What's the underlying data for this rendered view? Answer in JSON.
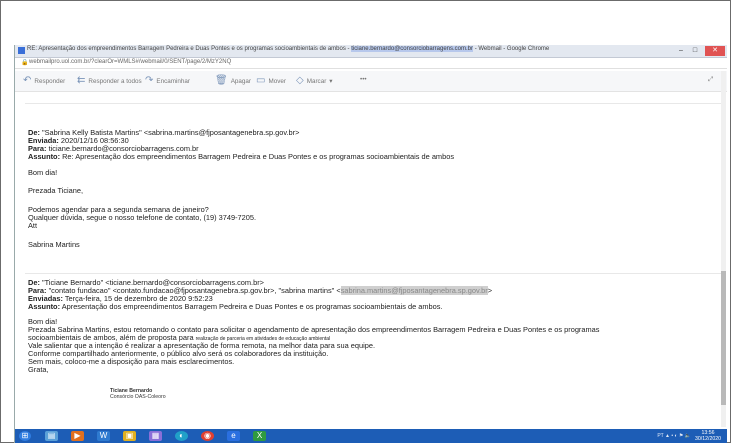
{
  "window": {
    "title_prefix": "RE: Apresentação dos empreendimentos Barragem Pedreira e Duas Pontes e os programas socioambientais de ambos -",
    "title_highlight": "ticiane.bernardo@consorciobarragens.com.br",
    "title_suffix": "- Webmail - Google Chrome",
    "min": "–",
    "max": "□",
    "close": "✕"
  },
  "address": {
    "url": "webmailpro.uol.com.br/?clearOr=WMLS#/webmail/0/SENT/page/2/MzY2NQ"
  },
  "toolbar": {
    "reply": "Responder",
    "reply_all": "Responder a todos",
    "forward": "Encaminhar",
    "delete": "Apagar",
    "move": "Mover",
    "mark": "Marcar",
    "mark_arrow": "▾",
    "more": "•••",
    "expand": "⤢"
  },
  "message1": {
    "from_label": "De:",
    "from_value": "\"Sabrina Kelly Batista Martins\" <sabrina.martins@fjposantagenebra.sp.gov.br>",
    "sent_label": "Enviada:",
    "sent_value": "2020/12/16 08:56:30",
    "to_label": "Para:",
    "to_value": "ticiane.bernardo@consorciobarragens.com.br",
    "subject_label": "Assunto:",
    "subject_value": "Re: Apresentação dos empreendimentos Barragem Pedreira e Duas Pontes e os programas socioambientais de ambos",
    "greeting": "Bom dia!",
    "salutation": "Prezada Ticiane,",
    "line1": "Podemos agendar para a segunda semana de janeiro?",
    "line2": "Qualquer dúvida, segue o nosso telefone de contato, (19) 3749-7205.",
    "closing": "Att",
    "signature": "Sabrina Martins"
  },
  "message2": {
    "from_label": "De:",
    "from_value": "\"Ticiane Bernardo\" <ticiane.bernardo@consorciobarragens.com.br>",
    "to_label": "Para:",
    "to_value": "\"contato fundacao\" <contato.fundacao@fjposantagenebra.sp.gov.br>, \"sabrina martins\" <",
    "to_highlight": "sabrina.martins@fjposantagenebra.sp.gov.br",
    "to_end": ">",
    "sent_label": "Enviadas:",
    "sent_value": "Terça-feira, 15 de dezembro de 2020 9:52:23",
    "subject_label": "Assunto:",
    "subject_value": "Apresentação dos empreendimentos Barragem Pedreira e Duas Pontes e os programas socioambientais de ambos.",
    "greeting": "Bom dia!",
    "body1": "Prezada Sabrina Martins, estou retomando o contato para solicitar o agendamento de apresentação dos empreendimentos Barragem Pedreira e Duas Pontes e os programas",
    "body2a": "socioambientais de ambos, além de proposta para",
    "body2b": "realização de parceria em atividades de educação ambiental",
    "body3": "Vale salientar que a intenção é realizar a apresentação de forma remota, na melhor data para sua equipe.",
    "body4": "Conforme compartilhado anteriormente, o público alvo será os colaboradores da instituição.",
    "body5": "Sem mais, coloco-me a disposição para mais esclarecimentos.",
    "closing": "Grata,",
    "sig_name": "Ticiane Bernardo",
    "sig_org": "Consórcio OAS-Coleoro"
  },
  "taskbar": {
    "tray_text": "PT ▲ • ◐ ⚑ 🔈",
    "time": "13:56",
    "date": "30/12/2020"
  },
  "colors": {
    "taskbar": "#1d5db6",
    "titlebar": "#e3e8f0",
    "close": "#e05353"
  }
}
